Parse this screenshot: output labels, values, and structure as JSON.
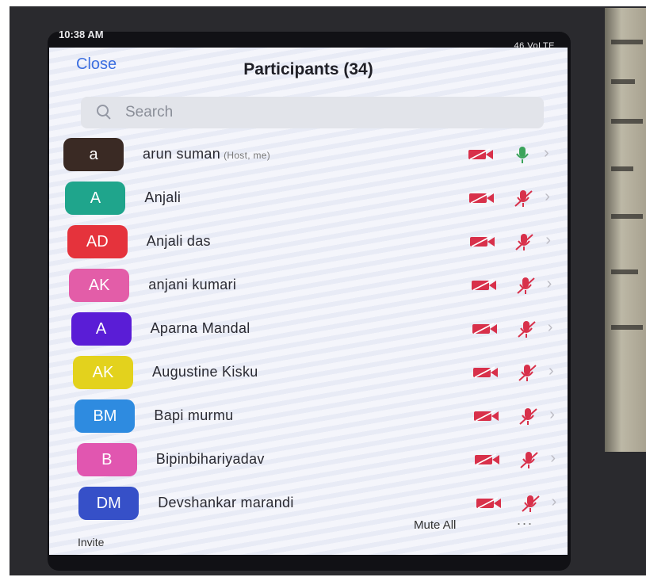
{
  "status": {
    "time": "10:38 AM",
    "network": "46 VoLTE"
  },
  "header": {
    "close_label": "Close",
    "title": "Participants (34)"
  },
  "search": {
    "placeholder": "Search"
  },
  "participants": [
    {
      "initials": "a",
      "name": "arun suman",
      "note": "(Host, me)",
      "color": "#3a2a24",
      "mic": "on"
    },
    {
      "initials": "A",
      "name": "Anjali",
      "color": "#1fa58c",
      "mic": "muted"
    },
    {
      "initials": "AD",
      "name": "Anjali das",
      "color": "#e5333c",
      "mic": "muted"
    },
    {
      "initials": "AK",
      "name": "anjani kumari",
      "color": "#e35da8",
      "mic": "muted"
    },
    {
      "initials": "A",
      "name": "Aparna Mandal",
      "color": "#5a1dd6",
      "mic": "muted"
    },
    {
      "initials": "AK",
      "name": "Augustine Kisku",
      "color": "#e3d21d",
      "mic": "muted"
    },
    {
      "initials": "BM",
      "name": "Bapi murmu",
      "color": "#2e8be0",
      "mic": "muted"
    },
    {
      "initials": "B",
      "name": "Bipinbihariyadav",
      "color": "#e156b0",
      "mic": "muted"
    },
    {
      "initials": "DM",
      "name": "Devshankar marandi",
      "color": "#3650c8",
      "mic": "muted"
    }
  ],
  "footer": {
    "mute_all_label": "Mute All",
    "more_label": "...",
    "invite_label": "Invite"
  },
  "colors": {
    "video_off": "#d8304a",
    "mic_on": "#3aa35a",
    "mic_muted": "#d8304a",
    "link": "#3d6fe0"
  }
}
